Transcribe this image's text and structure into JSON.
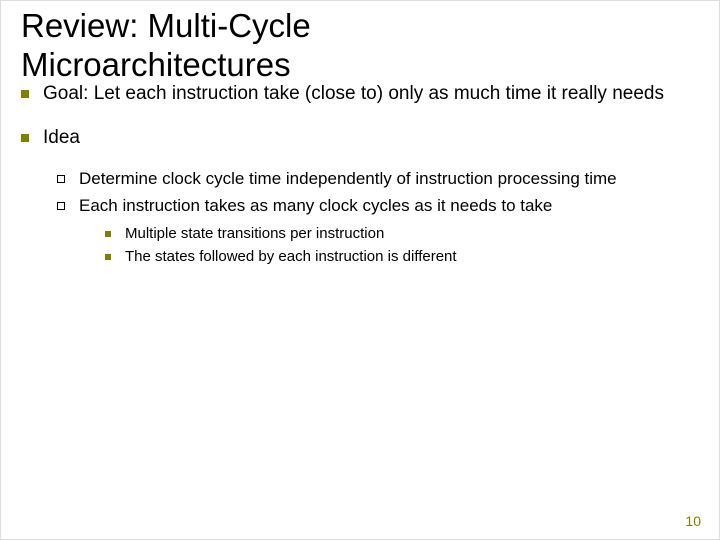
{
  "title_line1": "Review: Multi-Cycle",
  "title_line2": "Microarchitectures",
  "bullets": {
    "goal": "Goal: Let each instruction take (close to) only as much time it really needs",
    "idea": "Idea",
    "sub1": "Determine clock cycle time independently of instruction processing time",
    "sub2": "Each instruction takes as many clock cycles as it needs to take",
    "subsub1": "Multiple state transitions per instruction",
    "subsub2": "The states followed by each instruction is different"
  },
  "page_number": "10",
  "colors": {
    "accent": "#808000"
  }
}
